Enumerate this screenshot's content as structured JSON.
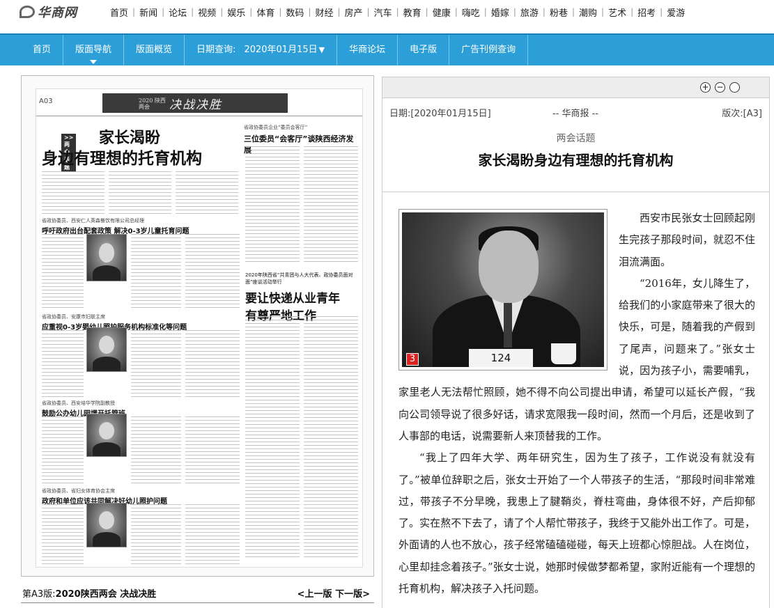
{
  "logo": {
    "text": "华商网"
  },
  "topnav": [
    "首页",
    "新闻",
    "论坛",
    "视频",
    "娱乐",
    "体育",
    "数码",
    "财经",
    "房产",
    "汽车",
    "教育",
    "健康",
    "嗨吃",
    "婚嫁",
    "旅游",
    "粉巷",
    "潮购",
    "艺术",
    "招考",
    "爱游"
  ],
  "mainnav": {
    "home": "首页",
    "layout_nav": "版面导航",
    "overview": "版面概览",
    "date_label": "日期查询:",
    "date_value": "2020年01月15日",
    "forum": "华商论坛",
    "epaper": "电子版",
    "ad_rates": "广告刊例查询"
  },
  "page_preview": {
    "page_no": "A03",
    "banner_sub": "2020 陕西两会",
    "banner": "决战决胜",
    "tag": ">>两会话题",
    "headline_1": "家长渴盼",
    "headline_2": "身边有理想的托育机构",
    "right_kicker": "省政协委员企业“委员会客厅”",
    "right_title": "三位委员“会客厅”谈陕西经济发展",
    "sec1_k": "省政协委员、西安仁人英森餐饮有限公司总经理",
    "sec1_t": "呼吁政府出台配套政策 解决0-3岁儿童托育问题",
    "sec2_k": "省政协委员、安康市妇联主席",
    "sec2_t": "应重视0-3岁婴幼儿照护服务机构标准化等问题",
    "sec3_k": "省政协委员、西安培华学院副教授",
    "sec3_t": "鼓励公办幼儿园增开托管班",
    "sec4_k": "省政协委员、省妇女体育协会主席",
    "sec4_t": "政府和单位应该共同解决好幼儿照护问题",
    "big2_k": "2020年陕西省“共青团与人大代表、政协委员面对面”座谈活动举行",
    "big2_t1": "要让快递从业青年",
    "big2_t2": "有尊严地工作"
  },
  "caption": {
    "prefix": "第A3版:",
    "title": "2020陕西两会 决战决胜",
    "prev": "<上一版",
    "next": "下一版>"
  },
  "article": {
    "date": "日期:[2020年01月15日]",
    "source": "-- 华商报 --",
    "edition": "版次:[A3]",
    "kicker": "两会话题",
    "title": "家长渴盼身边有理想的托育机构",
    "photo_badge": "3",
    "photo_plate": "124",
    "paragraphs": [
      "西安市民张女士回顾起刚生完孩子那段时间，就忍不住泪流满面。",
      "“2016年，女儿降生了，给我们的小家庭带来了很大的快乐，可是，随着我的产假到了尾声，问题来了。”张女士说，因为孩子小，需要哺乳，家里老人无法帮忙照顾，她不得不向公司提出申请，希望可以延长产假，“我向公司领导说了很多好话，请求宽限我一段时间，然而一个月后，还是收到了人事部的电话，说需要新人来顶替我的工作。",
      "“我上了四年大学、两年研究生，因为生了孩子，工作说没有就没有了。”被单位辞职之后，张女士开始了一个人带孩子的生活，“那段时间非常难过，带孩子不分早晚，我患上了腱鞘炎，脊柱弯曲，身体很不好，产后抑郁了。实在熬不下去了，请了个人帮忙带孩子，我终于又能外出工作了。可是，外面请的人也不放心，孩子经常磕磕碰碰，每天上班都心惊胆战。人在岗位，心里却挂念着孩子。”张女士说，她那时候做梦都希望，家附近能有一个理想的托育机构，解决孩子入托问题。"
    ]
  },
  "colors": {
    "nav_blue": "#2d9fd8",
    "badge_red": "#dd2222"
  },
  "icons": [
    "zoom-in-icon",
    "zoom-out-icon",
    "reset-icon"
  ]
}
